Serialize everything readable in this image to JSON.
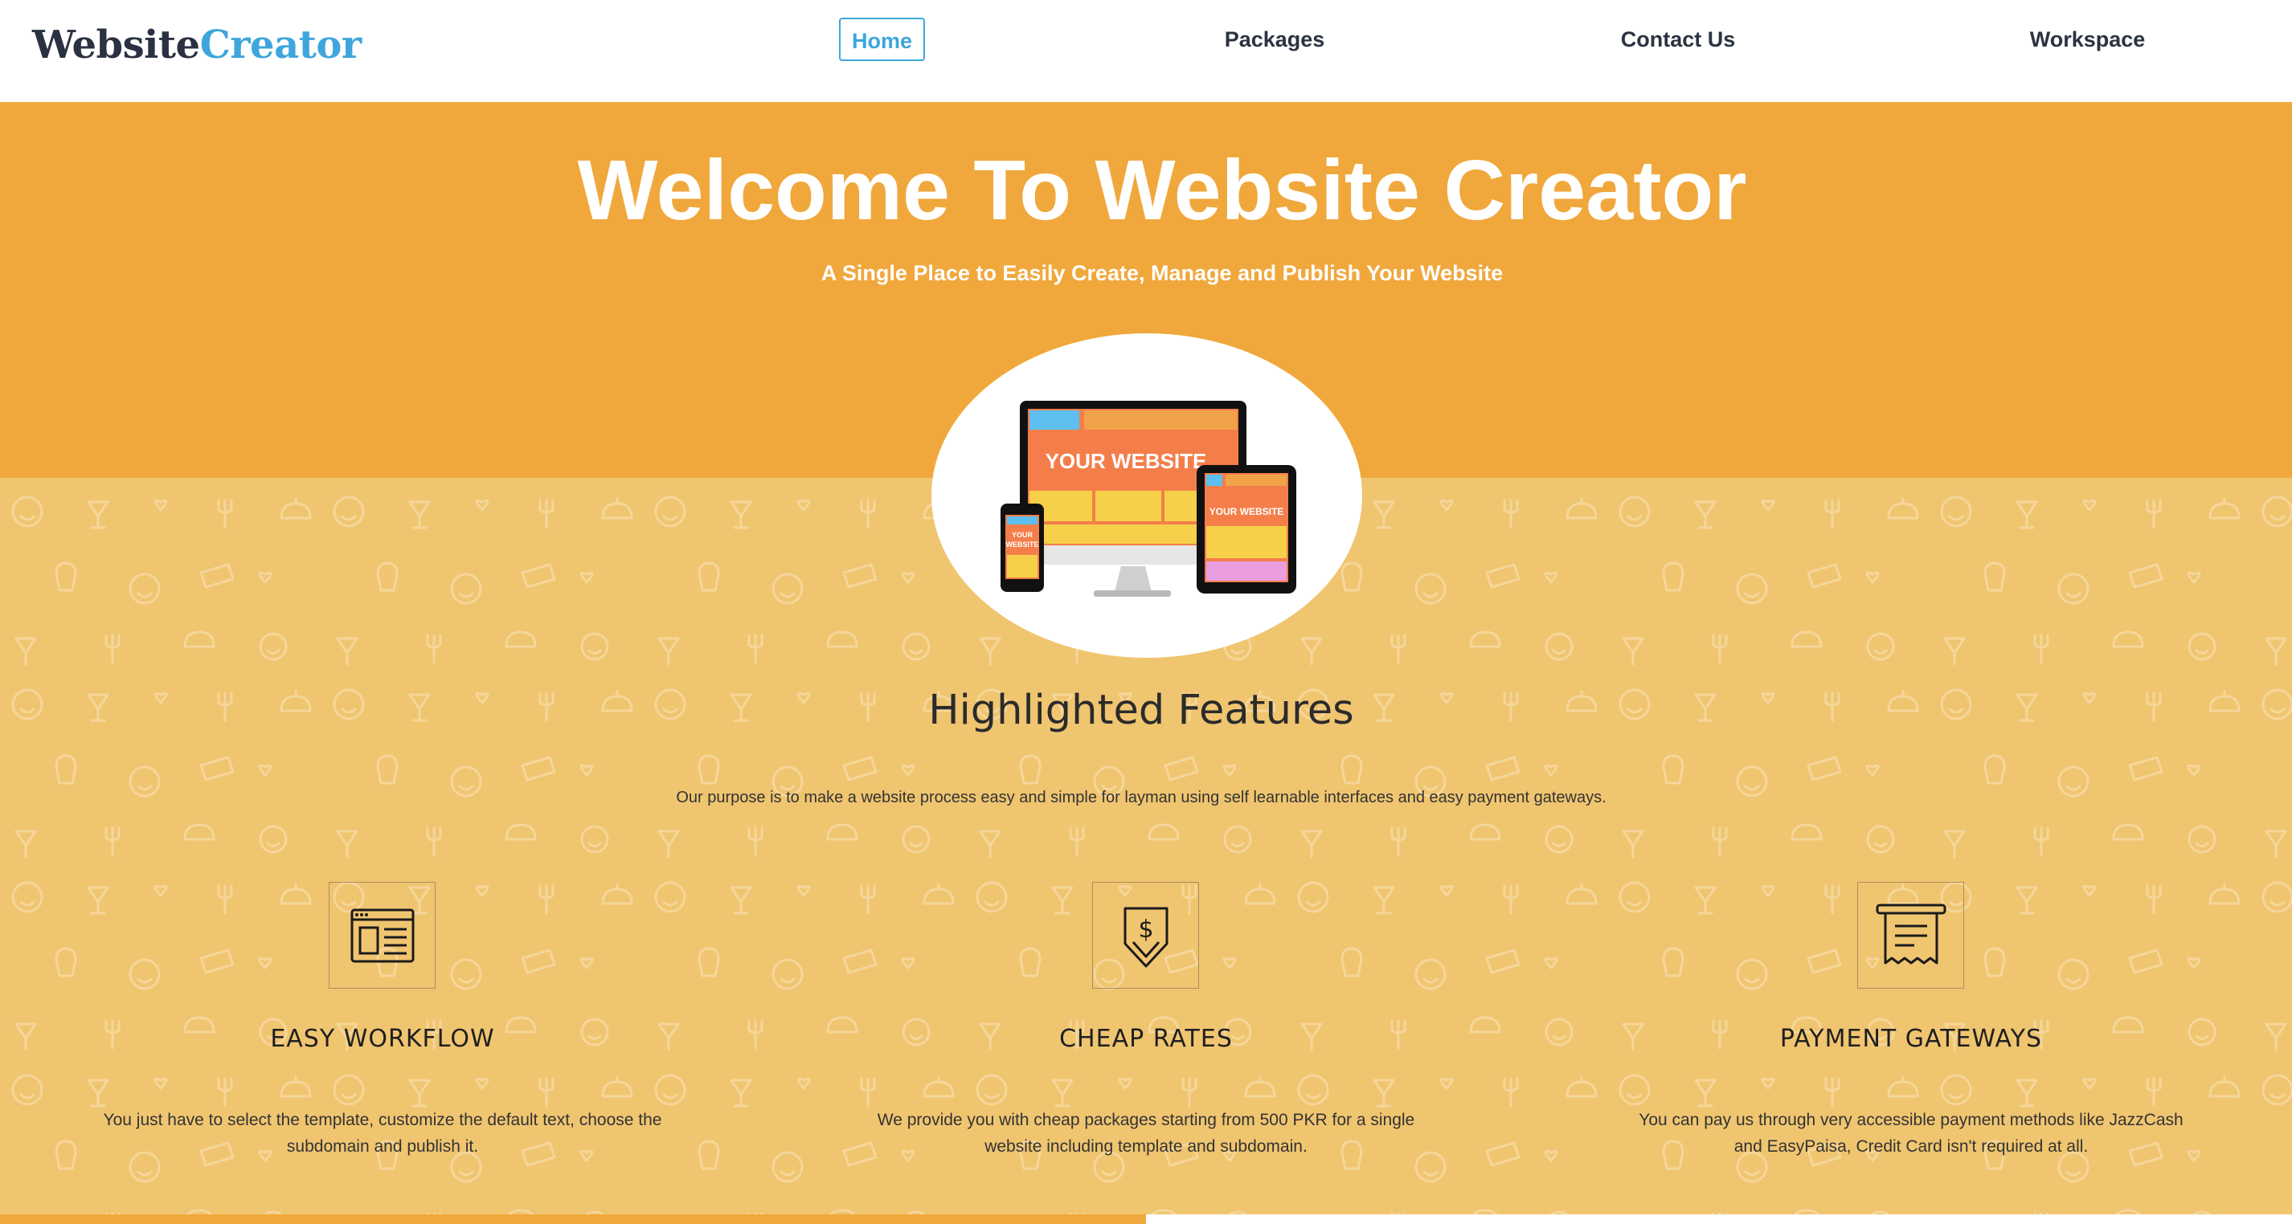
{
  "brand": {
    "part1": "Website",
    "part2": "Creator"
  },
  "nav": {
    "items": [
      {
        "label": "Home",
        "active": true
      },
      {
        "label": "Packages",
        "active": false
      },
      {
        "label": "Contact Us",
        "active": false
      },
      {
        "label": "Workspace",
        "active": false
      }
    ]
  },
  "hero": {
    "title": "Welcome To Website Creator",
    "subtitle": "A Single Place to Easily Create, Manage and Publish Your Website",
    "illustration": {
      "desktop_text": "YOUR WEBSITE",
      "tablet_text": "YOUR WEBSITE",
      "phone_text_line1": "YOUR",
      "phone_text_line2": "WEBSITE"
    }
  },
  "features_section": {
    "title": "Highlighted Features",
    "description": "Our purpose is to make a website process easy and simple for layman using self learnable interfaces and easy payment gateways.",
    "items": [
      {
        "icon": "browser-layout-icon",
        "title": "EASY WORKFLOW",
        "text": "You just have to select the template, customize the default text, choose the subdomain and publish it."
      },
      {
        "icon": "dollar-arrow-icon",
        "title": "CHEAP RATES",
        "text": "We provide you with cheap packages starting from 500 PKR for a single website including template and subdomain."
      },
      {
        "icon": "receipt-icon",
        "title": "PAYMENT GATEWAYS",
        "text": "You can pay us through very accessible payment methods like JazzCash and EasyPaisa, Credit Card isn't required at all."
      }
    ]
  },
  "colors": {
    "hero_bg": "#f0a83c",
    "pattern_bg": "#f0c570",
    "accent_blue": "#3ea6dc",
    "dark_text": "#2b3342"
  }
}
